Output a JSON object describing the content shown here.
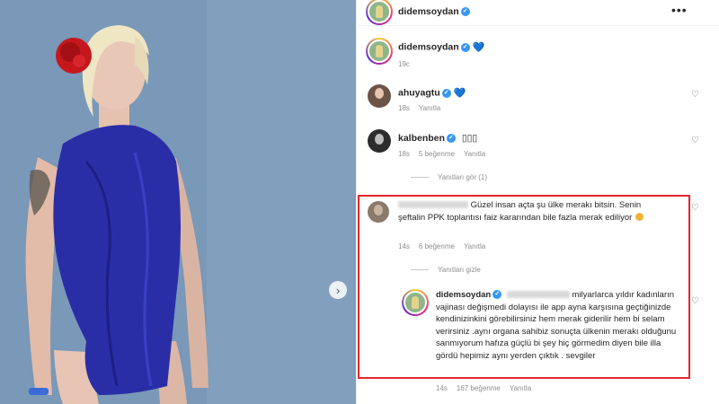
{
  "post": {
    "author": "didemsoydan",
    "more_glyph": "•••",
    "next_glyph": "›",
    "caption_heart": "💙",
    "caption_time": "19c"
  },
  "comments": [
    {
      "username": "ahuyagtu",
      "heart": "💙",
      "time": "18s",
      "reply_label": "Yanıtla"
    },
    {
      "username": "kalbenben",
      "text": "▯▯▯",
      "time": "18s",
      "likes": "5 beğenme",
      "reply_label": "Yanıtla",
      "view_replies": "Yanıtları gör (1)"
    },
    {
      "text": "Güzel insan açta şu ülke merakı bitsin. Senin şeftalin PPK toplantısı faiz kararından bile fazla merak ediliyor",
      "time": "14s",
      "likes": "6 beğenme",
      "reply_label": "Yanıtla",
      "hide_replies": "Yanıtları gizle"
    }
  ],
  "reply": {
    "username": "didemsoydan",
    "text": "milyarlarca yıldır kadınların vajinası değişmedi dolayısı ile app ayna karşısına geçtiğinizde kendinizinkini görebilirsiniz hem merak giderilir hem bi selam verirsiniz .aynı organa sahibiz sonuçta ülkenin merakı olduğunu sanmıyorum hafıza güçlü bi şey hiç görmedim diyen bile illa gördü hepimiz aynı yerden çıktık . sevgiler",
    "time": "14s",
    "likes": "167 beğenme",
    "reply_label": "Yanıtla"
  },
  "colors": {
    "highlight_border": "#e0282d",
    "dress": "#2a2ea6",
    "background_wall": "#7e9cbb",
    "flower": "#c6171d",
    "verified": "#3897f0"
  }
}
